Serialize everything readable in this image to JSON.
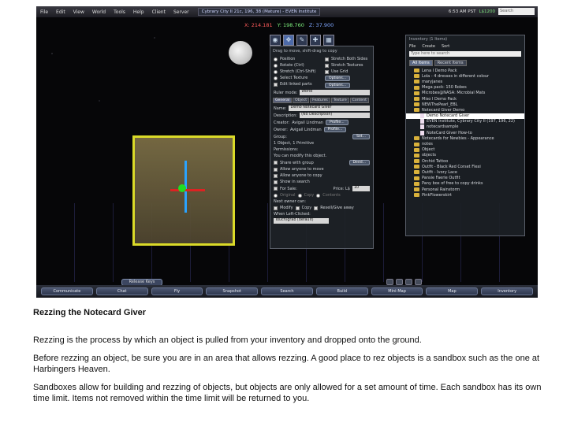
{
  "menubar": {
    "items": [
      "File",
      "Edit",
      "View",
      "World",
      "Tools",
      "Help",
      "Client",
      "Server"
    ],
    "location": "Cybrary City II 21c, 196, 38 (Mature) - EVEN Institute",
    "time": "6:53 AM PST",
    "balance": "L$1200",
    "search_placeholder": "Search"
  },
  "viewer": {
    "coords": {
      "x": "X: 214.181",
      "y": "Y: 198.760",
      "z": "Z: 37.900"
    },
    "tool_icons": [
      "focus-icon",
      "move-icon",
      "edit-icon",
      "create-icon",
      "land-icon"
    ]
  },
  "build": {
    "drag_hint": "Drag to move, shift-drag to copy",
    "options_left": [
      "Position",
      "Rotate (Ctrl)",
      "Stretch (Ctrl-Shift)",
      "Select Texture",
      "Edit linked parts"
    ],
    "options_right": [
      "Stretch Both Sides",
      "Stretch Textures",
      "Use Grid"
    ],
    "align_button": "Options...",
    "grid_button": "Options...",
    "ruler_label": "Ruler mode:",
    "ruler_value": "World",
    "tabs": [
      "General",
      "Object",
      "Features",
      "Texture",
      "Content"
    ],
    "name_label": "Name:",
    "name_value": "Demo Notecard Giver",
    "desc_label": "Description:",
    "desc_value": "(No Description)",
    "creator_label": "Creator:",
    "creator_value": "Avigail Lindman",
    "owner_label": "Owner:",
    "owner_value": "Avigail Lindman",
    "group_label": "Group:",
    "profile_button": "Profile...",
    "set_button": "Set...",
    "summary": "1 Object, 1 Primitive",
    "permissions_label": "Permissions:",
    "modify_text": "You can modify this object.",
    "perm_options": [
      "Share with group",
      "Allow anyone to move",
      "Allow anyone to copy",
      "Show in search",
      "For Sale:"
    ],
    "deed_button": "Deed...",
    "price_label": "Price: L$",
    "price_value": "10",
    "sale_types": [
      "Original",
      "Copy",
      "Contents"
    ],
    "next_owner_label": "Next owner can:",
    "next_owner_perms": [
      "Modify",
      "Copy",
      "Resell/Give away"
    ],
    "left_click_label": "When Left-Clicked:",
    "left_click_value": "Touch/grab (default)"
  },
  "inventory": {
    "title": "Inventory (1 Items)",
    "menu": [
      "File",
      "Create",
      "Sort"
    ],
    "filter_placeholder": "Type here to search",
    "tabs": [
      "All Items",
      "Recent Items"
    ],
    "items": [
      {
        "label": "Lena I Demo Pack",
        "type": "folder",
        "selected": false
      },
      {
        "label": "Lola - 4 dresses in different colour",
        "type": "folder",
        "selected": false
      },
      {
        "label": "maryjanes",
        "type": "folder",
        "selected": false
      },
      {
        "label": "Mega pack: 150 Robes",
        "type": "folder",
        "selected": false
      },
      {
        "label": "Microbes@NASA: Microbial Mats",
        "type": "folder",
        "selected": false
      },
      {
        "label": "Miso I Demo Pack",
        "type": "folder",
        "selected": false
      },
      {
        "label": "NEWThePearl_EBL",
        "type": "folder",
        "selected": false
      },
      {
        "label": "Notecard Giver Demo",
        "type": "folder",
        "selected": false
      },
      {
        "label": "Demo Notecard Giver",
        "type": "object",
        "selected": true
      },
      {
        "label": "EVEN Institute, Cybrary City II (197, 196, 22)",
        "type": "landmark",
        "selected": false
      },
      {
        "label": "notecardsample",
        "type": "notecard",
        "selected": false
      },
      {
        "label": "NoteCard Giver How-to",
        "type": "notecard",
        "selected": false
      },
      {
        "label": "Notecards for Newbies - Appearance",
        "type": "folder",
        "selected": false
      },
      {
        "label": "notes",
        "type": "folder",
        "selected": false
      },
      {
        "label": "Object",
        "type": "folder",
        "selected": false
      },
      {
        "label": "objects",
        "type": "folder",
        "selected": false
      },
      {
        "label": "Orchid Tattoo",
        "type": "folder",
        "selected": false
      },
      {
        "label": "Outfit - Black Red Corset Flexi",
        "type": "folder",
        "selected": false
      },
      {
        "label": "Outfit - Ivory Lace",
        "type": "folder",
        "selected": false
      },
      {
        "label": "Pansie Faerie Outfit",
        "type": "folder",
        "selected": false
      },
      {
        "label": "Pany box of free to copy drinks",
        "type": "folder",
        "selected": false
      },
      {
        "label": "Personal Rainstorm",
        "type": "folder",
        "selected": false
      },
      {
        "label": "PinkFlowerskirt",
        "type": "folder",
        "selected": false
      }
    ]
  },
  "bottombar": {
    "release_keys": "Release Keys",
    "buttons": [
      "Communicate",
      "Chat",
      "Fly",
      "Snapshot",
      "Search",
      "Build",
      "Mini-Map",
      "Map",
      "Inventory"
    ]
  },
  "caption": {
    "heading": "Rezzing the Notecard Giver",
    "p1": "Rezzing is the process by which an object is pulled from your inventory and dropped onto the ground.",
    "p2": "Before rezzing an object, be sure you are in an area that allows rezzing. A good place to rez objects is a sandbox such as the one at Harbingers Heaven.",
    "p3": "Sandboxes allow for building and rezzing of objects, but objects are only allowed for a set amount of time. Each sandbox has its own time limit. Items not removed within the time limit will be returned to you."
  }
}
